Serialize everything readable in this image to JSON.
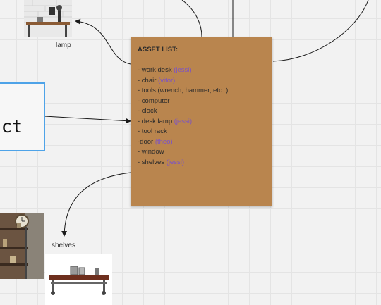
{
  "board": {
    "frame_label": "ct",
    "lamp_caption": "lamp",
    "shelves_caption": "shelves",
    "sticky_note": {
      "title": "ASSET LIST:",
      "items": [
        {
          "text": "- work desk",
          "owner": "(jessi)"
        },
        {
          "text": "- chair",
          "owner": "(vitor)"
        },
        {
          "text": "- tools (wrench, hammer, etc..)",
          "owner": ""
        },
        {
          "text": "- computer",
          "owner": ""
        },
        {
          "text": "- clock",
          "owner": ""
        },
        {
          "text": "- desk lamp",
          "owner": "(jessi)"
        },
        {
          "text": "- tool rack",
          "owner": ""
        },
        {
          "text": "-door",
          "owner": "(theo)"
        },
        {
          "text": "- window",
          "owner": ""
        },
        {
          "text": "- shelves",
          "owner": "(jessi)"
        }
      ]
    }
  },
  "colors": {
    "sticky_note": "#b9854e",
    "owner_text": "#7b52c6",
    "frame_border": "#4ea3e8",
    "canvas": "#f2f2f2"
  }
}
